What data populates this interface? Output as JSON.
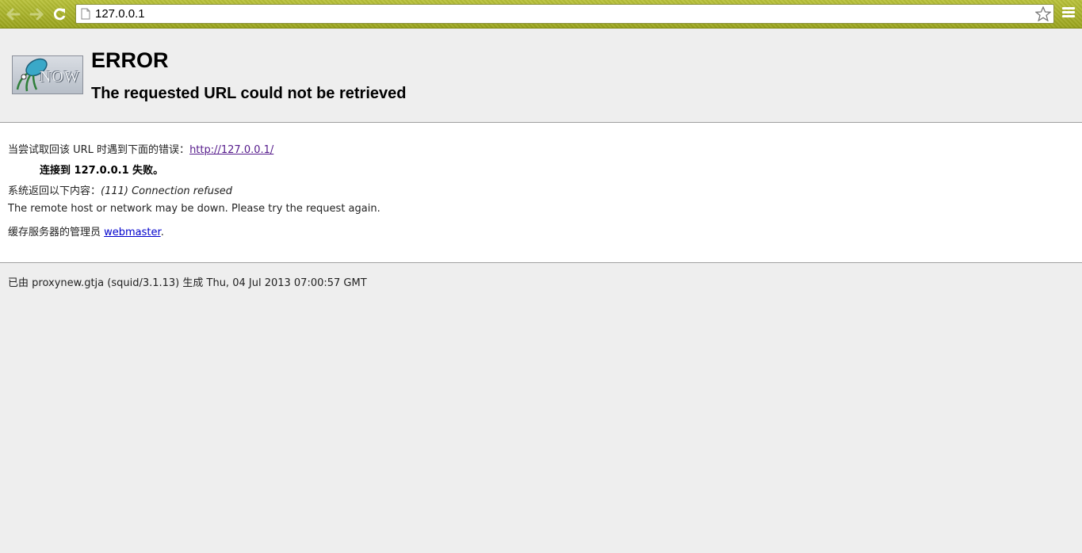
{
  "browser": {
    "url": "127.0.0.1",
    "accent": "#a8b12a"
  },
  "header": {
    "logo_text": "NOW",
    "title": "ERROR",
    "subtitle": "The requested URL could not be retrieved"
  },
  "content": {
    "intro_label": "当尝试取回该 URL 时遇到下面的错误：",
    "intro_link": "http://127.0.0.1/",
    "failure": "连接到 127.0.0.1 失败。",
    "system_label": "系统返回以下内容：",
    "system_value": "(111) Connection refused",
    "remote_msg": "The remote host or network may be down. Please try the request again.",
    "admin_label": "缓存服务器的管理员 ",
    "admin_link": "webmaster",
    "admin_suffix": "."
  },
  "footer": {
    "generated": "已由 proxynew.gtja (squid/3.1.13) 生成 Thu, 04 Jul 2013 07:00:57 GMT"
  }
}
